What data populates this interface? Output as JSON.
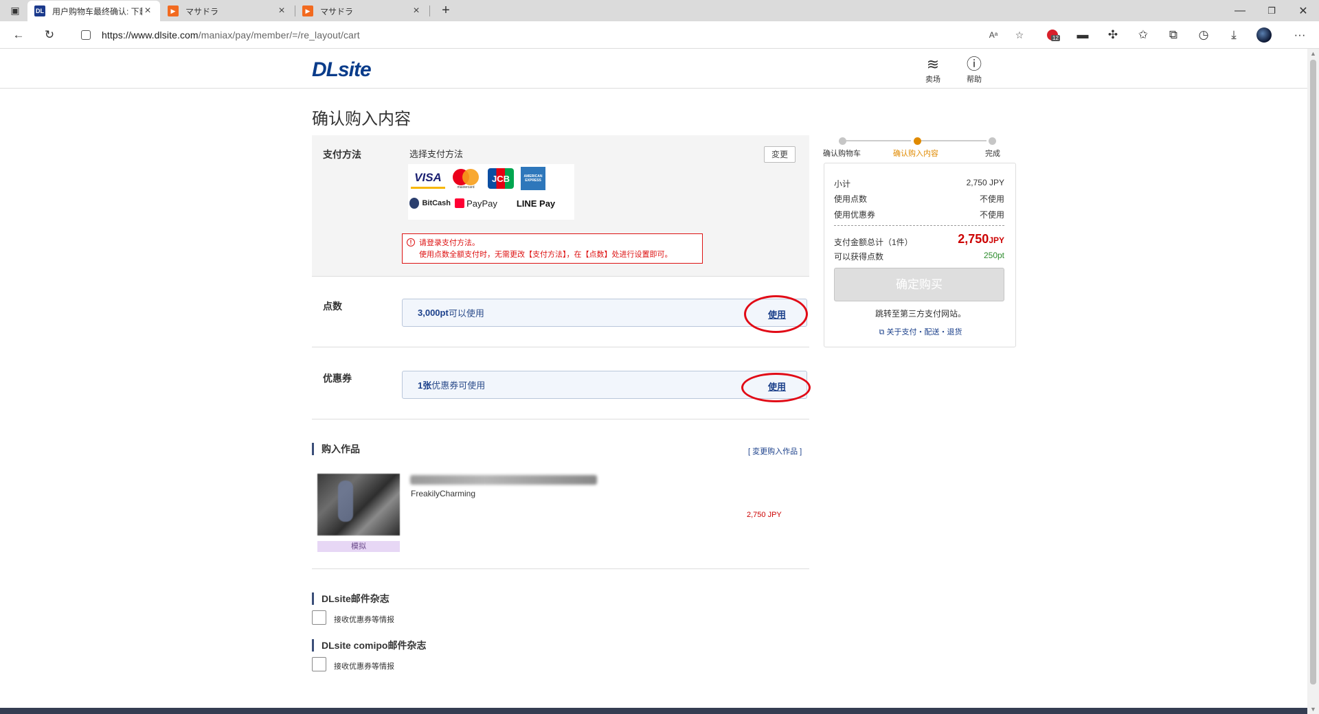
{
  "browser": {
    "tabs": [
      {
        "title": "用户购物车最终确认: 下載同人志",
        "favicon": "DL",
        "favicon_color": "#1b3a8c",
        "active": true
      },
      {
        "title": "マサドラ",
        "favicon": "▶",
        "favicon_color": "#f26a1f",
        "active": false
      },
      {
        "title": "マサドラ",
        "favicon": "▶",
        "favicon_color": "#f26a1f",
        "active": false
      }
    ],
    "new_tab": "+",
    "url_host": "https://www.dlsite.com",
    "url_path": "/maniax/pay/member/=/re_layout/cart",
    "badge_count": "12"
  },
  "header": {
    "logo": "DLsite",
    "nav": [
      {
        "label": "卖场",
        "icon": "layers-icon"
      },
      {
        "label": "帮助",
        "icon": "help-icon"
      }
    ]
  },
  "page_title": "确认购入内容",
  "payment": {
    "label": "支付方法",
    "select_text": "选择支付方法",
    "change_button": "変更",
    "methods": [
      "VISA",
      "mastercard",
      "JCB",
      "AMERICAN EXPRESS",
      "BitCash",
      "PayPay",
      "LINE Pay"
    ],
    "error_line1": "请登录支付方法。",
    "error_line2": "使用点数全额支付时，无需更改【支付方法】，在【点数】处进行设置即可。"
  },
  "points": {
    "label": "点数",
    "amount": "3,000pt",
    "suffix": "可以使用",
    "use_link": "使用"
  },
  "coupon": {
    "label": "优惠券",
    "amount": "1张",
    "suffix": "优惠券可使用",
    "use_link": "使用"
  },
  "purchase": {
    "heading": "购入作品",
    "change_link": "[ 変更购入作品 ]",
    "item": {
      "circle": "FreakilyCharming",
      "price": "2,750 JPY",
      "tag": "模拟"
    }
  },
  "newsletters": [
    {
      "heading": "DLsite邮件杂志",
      "checkbox_label": "接收优惠券等情报"
    },
    {
      "heading": "DLsite comipo邮件杂志",
      "checkbox_label": "接收优惠券等情报"
    }
  ],
  "steps": [
    {
      "label": "确认购物车",
      "state": "done"
    },
    {
      "label": "确认购入内容",
      "state": "current"
    },
    {
      "label": "完成",
      "state": "todo"
    }
  ],
  "summary": {
    "subtotal_label": "小计",
    "subtotal": "2,750 JPY",
    "points_label": "使用点数",
    "points_value": "不使用",
    "coupon_label": "使用优惠券",
    "coupon_value": "不使用",
    "total_label": "支付金额总计（1件）",
    "total_value": "2,750",
    "total_unit": "JPY",
    "earn_label": "可以获得点数",
    "earn_value": "250pt",
    "buy_button": "确定购买",
    "note": "跳转至第三方支付网站。",
    "about_link": "关于支付・配送・退货"
  },
  "colors": {
    "accent": "#1a3f8a",
    "error": "#dd1111",
    "price": "#cc0000",
    "step_current": "#e08a00",
    "annotation_ring": "#e10a16"
  }
}
